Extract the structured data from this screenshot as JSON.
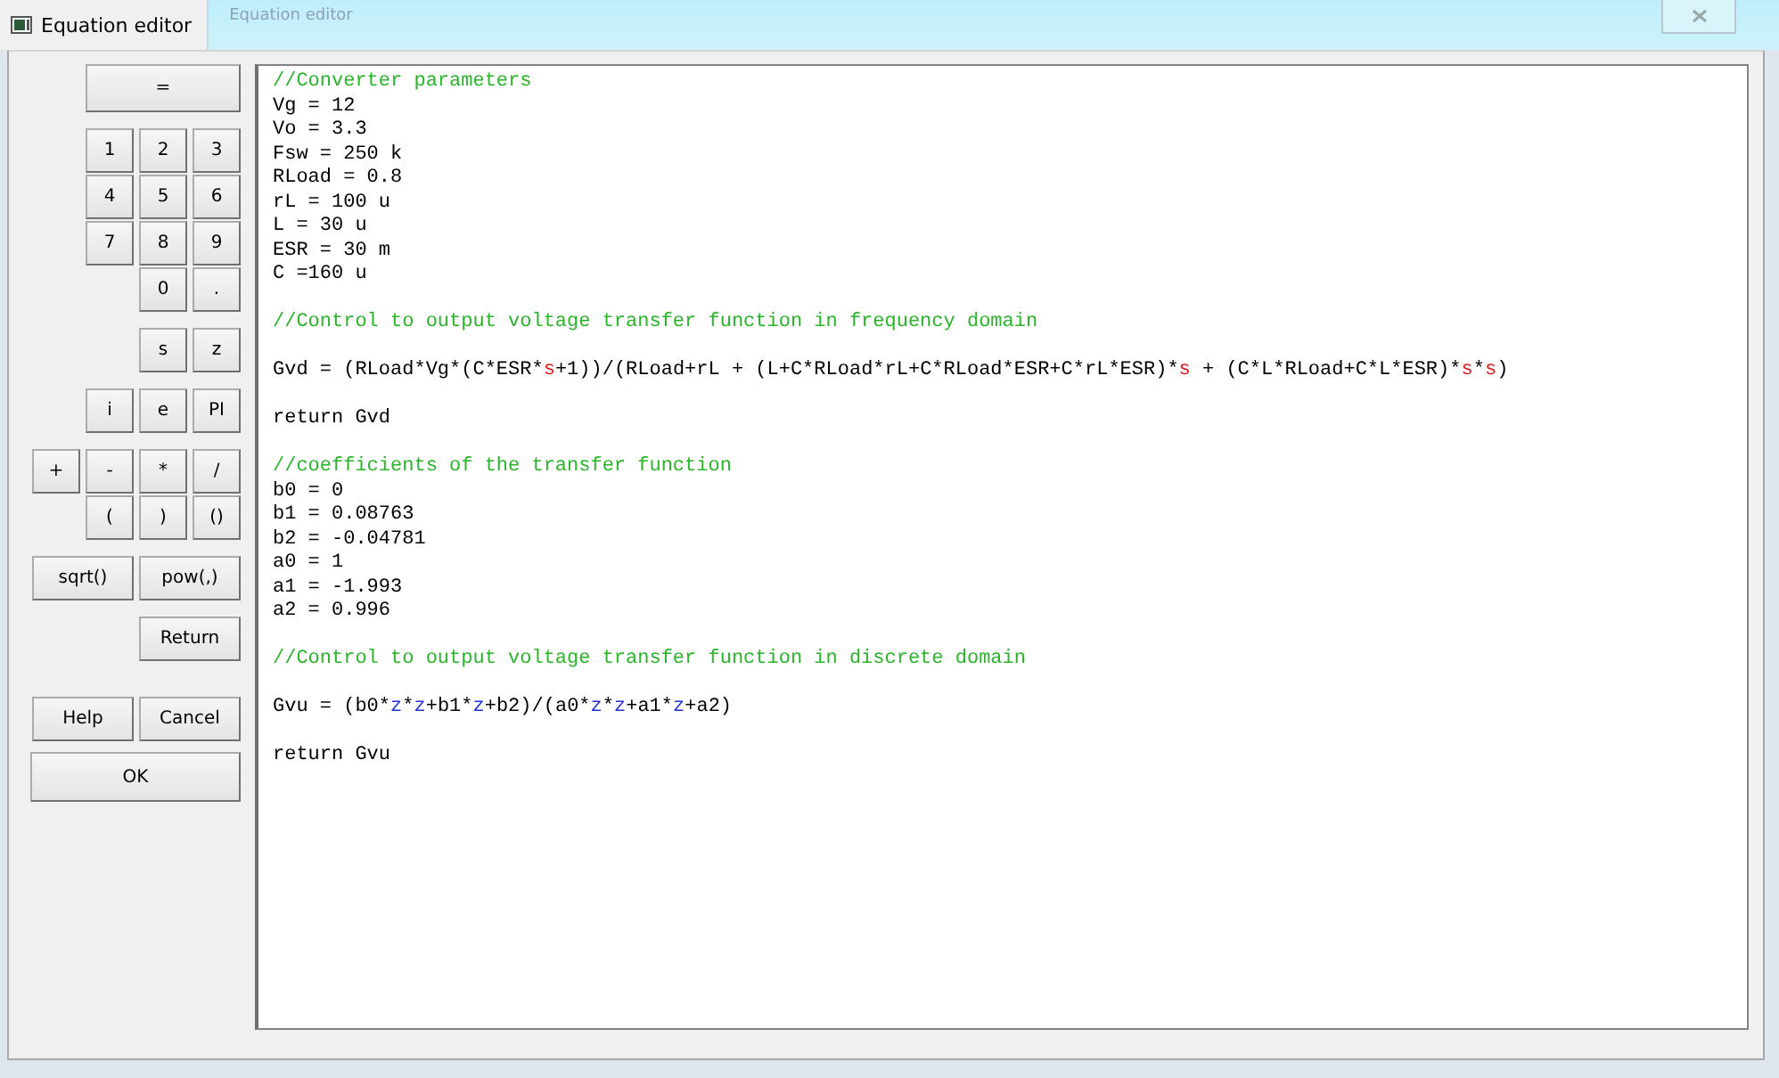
{
  "window": {
    "tab_title": "Equation editor",
    "caption": "Equation editor"
  },
  "keypad": [
    {
      "rows": [
        [
          {
            "label": "=",
            "kind": "triple"
          }
        ]
      ]
    },
    {
      "rows": [
        [
          {
            "label": "1",
            "kind": "small"
          },
          {
            "label": "2",
            "kind": "small"
          },
          {
            "label": "3",
            "kind": "small"
          }
        ],
        [
          {
            "label": "4",
            "kind": "small"
          },
          {
            "label": "5",
            "kind": "small"
          },
          {
            "label": "6",
            "kind": "small"
          }
        ],
        [
          {
            "label": "7",
            "kind": "small"
          },
          {
            "label": "8",
            "kind": "small"
          },
          {
            "label": "9",
            "kind": "small"
          }
        ],
        [
          "",
          {
            "label": "0",
            "kind": "small"
          },
          {
            "label": ".",
            "kind": "small"
          }
        ]
      ]
    },
    {
      "rows": [
        [
          {
            "label": "s",
            "kind": "small"
          },
          {
            "label": "z",
            "kind": "small"
          }
        ]
      ]
    },
    {
      "rows": [
        [
          {
            "label": "i",
            "kind": "small"
          },
          {
            "label": "e",
            "kind": "small"
          },
          {
            "label": "PI",
            "kind": "small"
          }
        ]
      ]
    },
    {
      "rows": [
        [
          {
            "label": "+",
            "kind": "small"
          },
          {
            "label": "-",
            "kind": "small"
          },
          {
            "label": "*",
            "kind": "small"
          },
          {
            "label": "/",
            "kind": "small"
          }
        ],
        [
          "",
          {
            "label": "(",
            "kind": "small"
          },
          {
            "label": ")",
            "kind": "small"
          },
          {
            "label": "()",
            "kind": "small"
          }
        ]
      ]
    },
    {
      "rows": [
        [
          {
            "label": "sqrt()",
            "kind": "wide"
          },
          {
            "label": "pow(,)",
            "kind": "wide"
          }
        ]
      ]
    },
    {
      "rows": [
        [
          {
            "label": "Return",
            "kind": "wide"
          }
        ]
      ]
    },
    {
      "rows": [
        [
          {
            "label": "Help",
            "kind": "wide"
          },
          {
            "label": "Cancel",
            "kind": "wide"
          }
        ],
        [
          {
            "label": "OK",
            "kind": "full"
          }
        ]
      ]
    }
  ],
  "editor": {
    "blocks": [
      [
        {
          "kind": "comment",
          "segments": [
            {
              "text": "//Converter parameters",
              "kind": "plain"
            }
          ]
        },
        {
          "kind": "code",
          "segments": [
            {
              "text": "Vg = 12",
              "kind": "plain"
            }
          ]
        },
        {
          "kind": "code",
          "segments": [
            {
              "text": "Vo = 3.3",
              "kind": "plain"
            }
          ]
        },
        {
          "kind": "code",
          "segments": [
            {
              "text": "Fsw = 250 k",
              "kind": "plain"
            }
          ]
        },
        {
          "kind": "code",
          "segments": [
            {
              "text": "RLoad = 0.8",
              "kind": "plain"
            }
          ]
        },
        {
          "kind": "code",
          "segments": [
            {
              "text": "rL = 100 u",
              "kind": "plain"
            }
          ]
        },
        {
          "kind": "code",
          "segments": [
            {
              "text": "L = 30 u",
              "kind": "plain"
            }
          ]
        },
        {
          "kind": "code",
          "segments": [
            {
              "text": "ESR = 30 m",
              "kind": "plain"
            }
          ]
        },
        {
          "kind": "code",
          "segments": [
            {
              "text": "C =160 u",
              "kind": "plain"
            }
          ]
        }
      ],
      [
        {
          "kind": "comment",
          "segments": [
            {
              "text": "//Control to output voltage transfer function in frequency domain",
              "kind": "plain"
            }
          ]
        }
      ],
      [
        {
          "kind": "code",
          "segments": [
            {
              "text": "Gvd = (RLoad*Vg*(C*ESR*",
              "kind": "plain"
            },
            {
              "text": "s",
              "kind": "s_variable"
            },
            {
              "text": "+1))/(RLoad+rL + (L+C*RLoad*rL+C*RLoad*ESR+C*rL*ESR)*",
              "kind": "plain"
            },
            {
              "text": "s",
              "kind": "s_variable"
            },
            {
              "text": " + (C*L*RLoad+C*L*ESR)*",
              "kind": "plain"
            },
            {
              "text": "s",
              "kind": "s_variable"
            },
            {
              "text": "*",
              "kind": "plain"
            },
            {
              "text": "s",
              "kind": "s_variable"
            },
            {
              "text": ")",
              "kind": "plain"
            }
          ]
        }
      ],
      [
        {
          "kind": "code",
          "segments": [
            {
              "text": "return Gvd",
              "kind": "plain"
            }
          ]
        }
      ],
      [
        {
          "kind": "comment",
          "segments": [
            {
              "text": "//coefficients of the transfer function",
              "kind": "plain"
            }
          ]
        },
        {
          "kind": "code",
          "segments": [
            {
              "text": "b0 = 0",
              "kind": "plain"
            }
          ]
        },
        {
          "kind": "code",
          "segments": [
            {
              "text": "b1 = 0.08763",
              "kind": "plain"
            }
          ]
        },
        {
          "kind": "code",
          "segments": [
            {
              "text": "b2 = -0.04781",
              "kind": "plain"
            }
          ]
        },
        {
          "kind": "code",
          "segments": [
            {
              "text": "a0 = 1",
              "kind": "plain"
            }
          ]
        },
        {
          "kind": "code",
          "segments": [
            {
              "text": "a1 = -1.993",
              "kind": "plain"
            }
          ]
        },
        {
          "kind": "code",
          "segments": [
            {
              "text": "a2 = 0.996",
              "kind": "plain"
            }
          ]
        }
      ],
      [
        {
          "kind": "comment",
          "segments": [
            {
              "text": "//Control to output voltage transfer function in discrete domain",
              "kind": "plain"
            }
          ]
        }
      ],
      [
        {
          "kind": "code",
          "segments": [
            {
              "text": "Gvu = (b0*",
              "kind": "plain"
            },
            {
              "text": "z",
              "kind": "z_variable"
            },
            {
              "text": "*",
              "kind": "plain"
            },
            {
              "text": "z",
              "kind": "z_variable"
            },
            {
              "text": "+b1*",
              "kind": "plain"
            },
            {
              "text": "z",
              "kind": "z_variable"
            },
            {
              "text": "+b2)/(a0*",
              "kind": "plain"
            },
            {
              "text": "z",
              "kind": "z_variable"
            },
            {
              "text": "*",
              "kind": "plain"
            },
            {
              "text": "z",
              "kind": "z_variable"
            },
            {
              "text": "+a1*",
              "kind": "plain"
            },
            {
              "text": "z",
              "kind": "z_variable"
            },
            {
              "text": "+a2)",
              "kind": "plain"
            }
          ]
        }
      ],
      [
        {
          "kind": "code",
          "segments": [
            {
              "text": "return Gvu",
              "kind": "plain"
            }
          ]
        }
      ]
    ]
  }
}
